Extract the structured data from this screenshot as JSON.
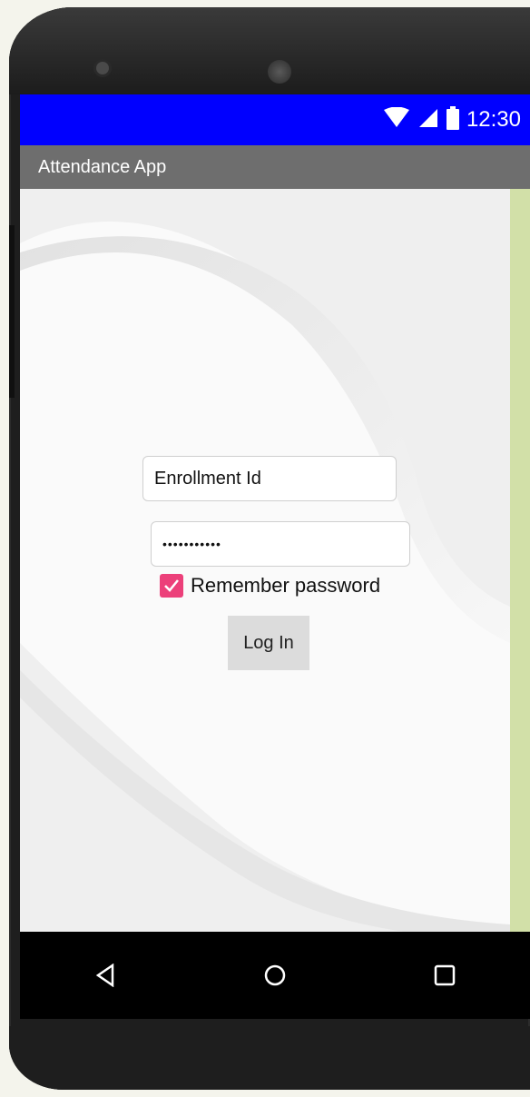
{
  "status_bar": {
    "time": "12:30",
    "background": "#0000ff",
    "icons": [
      "wifi-icon",
      "signal-icon",
      "battery-icon"
    ]
  },
  "title_bar": {
    "title": "Attendance App"
  },
  "login_form": {
    "enrollment_value": "Enrollment Id",
    "password_mask": "•••••••••••",
    "remember_checked": true,
    "remember_label": "Remember password",
    "login_label": "Log In"
  },
  "nav_bar": {
    "icons": [
      "back-icon",
      "home-icon",
      "recents-icon"
    ]
  },
  "colors": {
    "accent": "#ec407a",
    "title_bar": "#6e6e6e",
    "side_strip": "#d2e0a8"
  }
}
